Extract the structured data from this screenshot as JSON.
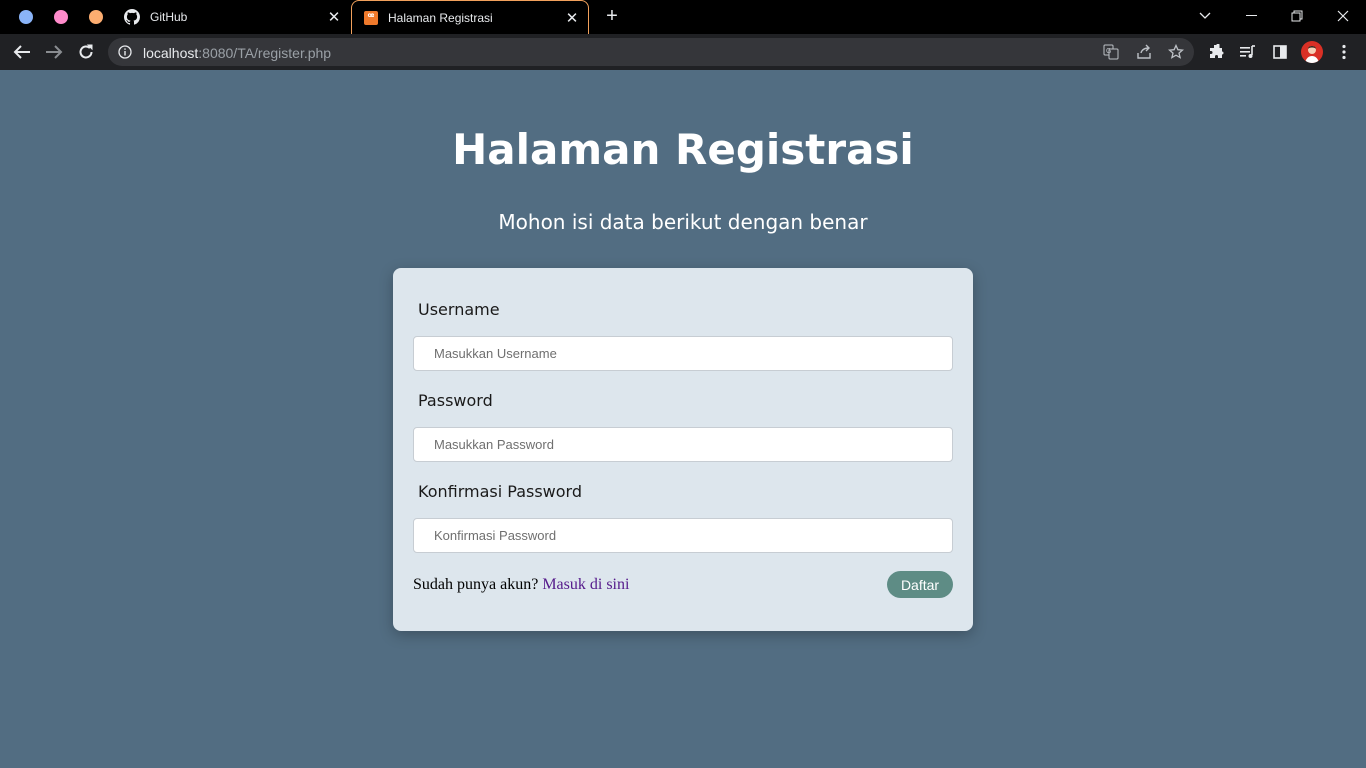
{
  "browser": {
    "tab_groups": [
      {
        "color": "#8ab4f8"
      },
      {
        "color": "#ff8bcb"
      },
      {
        "color": "#fcad70"
      }
    ],
    "tabs": [
      {
        "title": "GitHub",
        "icon": "github-icon",
        "active": false
      },
      {
        "title": "Halaman Registrasi",
        "icon": "xampp-icon",
        "active": true
      }
    ],
    "active_tab_border_color": "#f2a15c",
    "address_bar": {
      "host": "localhost",
      "path": ":8080/TA/register.php"
    }
  },
  "page": {
    "background": "#526d82",
    "title": "Halaman Registrasi",
    "subtitle": "Mohon isi data berikut dengan benar",
    "form": {
      "fields": [
        {
          "label": "Username",
          "placeholder": "Masukkan Username",
          "value": ""
        },
        {
          "label": "Password",
          "placeholder": "Masukkan Password",
          "value": ""
        },
        {
          "label": "Konfirmasi Password",
          "placeholder": "Konfirmasi Password",
          "value": ""
        }
      ],
      "login_prompt": "Sudah punya akun?",
      "login_link": "Masuk di sini",
      "submit_label": "Daftar",
      "submit_color": "#5e8c85"
    }
  }
}
